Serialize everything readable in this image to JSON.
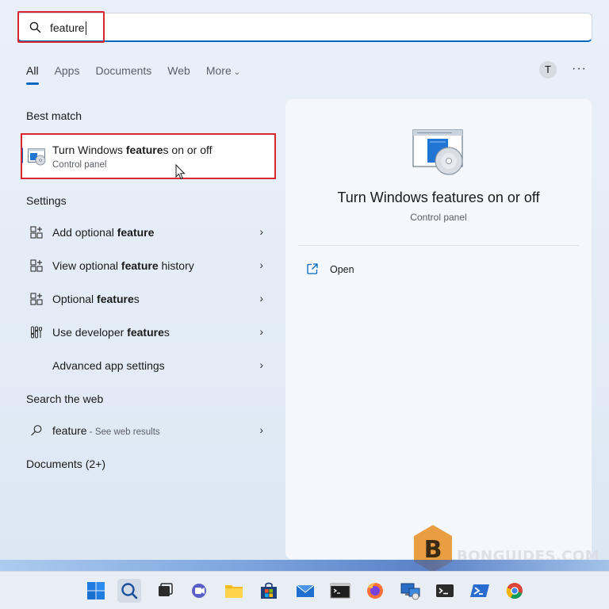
{
  "search": {
    "value": "feature"
  },
  "tabs": [
    {
      "label": "All",
      "active": true
    },
    {
      "label": "Apps"
    },
    {
      "label": "Documents"
    },
    {
      "label": "Web"
    },
    {
      "label": "More"
    }
  ],
  "account": {
    "initial": "T"
  },
  "sections": {
    "best_match": "Best match",
    "settings": "Settings",
    "search_web": "Search the web",
    "documents": "Documents (2+)"
  },
  "best_match": {
    "title_before": "Turn Windows ",
    "title_bold": "feature",
    "title_after": "s on or off",
    "subtitle": "Control panel"
  },
  "settings_items": [
    {
      "before": "Add optional ",
      "bold": "feature",
      "after": "",
      "icon": "add-feature-icon"
    },
    {
      "before": "View optional ",
      "bold": "feature",
      "after": " history",
      "icon": "feature-history-icon"
    },
    {
      "before": "Optional ",
      "bold": "feature",
      "after": "s",
      "icon": "optional-features-icon"
    },
    {
      "before": "Use developer ",
      "bold": "feature",
      "after": "s",
      "icon": "developer-tools-icon"
    },
    {
      "before": "Advanced app settings",
      "bold": "",
      "after": "",
      "icon": ""
    }
  ],
  "web_result": {
    "query": "feature",
    "suffix": " - See web results"
  },
  "preview": {
    "title": "Turn Windows features on or off",
    "subtitle": "Control panel",
    "open_label": "Open"
  },
  "watermark": {
    "text": "BONGUIDES.COM",
    "letter": "B"
  },
  "taskbar": [
    "windows-start-icon",
    "search-icon",
    "task-view-icon",
    "chat-icon",
    "file-explorer-icon",
    "store-icon",
    "mail-icon",
    "command-prompt-icon",
    "firefox-icon",
    "remote-desktop-icon",
    "terminal-icon",
    "powershell-icon",
    "chrome-icon"
  ],
  "colors": {
    "accent": "#0067c0",
    "highlight": "#d9252c"
  }
}
